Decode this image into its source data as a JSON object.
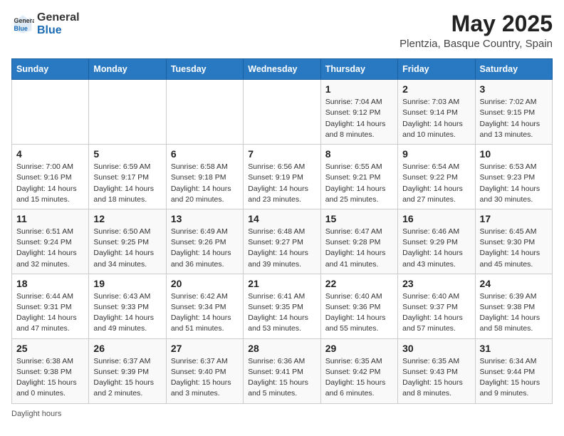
{
  "logo": {
    "line1": "General",
    "line2": "Blue"
  },
  "title": "May 2025",
  "location": "Plentzia, Basque Country, Spain",
  "days_of_week": [
    "Sunday",
    "Monday",
    "Tuesday",
    "Wednesday",
    "Thursday",
    "Friday",
    "Saturday"
  ],
  "legend_label": "Daylight hours",
  "weeks": [
    [
      {
        "day": "",
        "info": ""
      },
      {
        "day": "",
        "info": ""
      },
      {
        "day": "",
        "info": ""
      },
      {
        "day": "",
        "info": ""
      },
      {
        "day": "1",
        "info": "Sunrise: 7:04 AM\nSunset: 9:12 PM\nDaylight: 14 hours\nand 8 minutes."
      },
      {
        "day": "2",
        "info": "Sunrise: 7:03 AM\nSunset: 9:14 PM\nDaylight: 14 hours\nand 10 minutes."
      },
      {
        "day": "3",
        "info": "Sunrise: 7:02 AM\nSunset: 9:15 PM\nDaylight: 14 hours\nand 13 minutes."
      }
    ],
    [
      {
        "day": "4",
        "info": "Sunrise: 7:00 AM\nSunset: 9:16 PM\nDaylight: 14 hours\nand 15 minutes."
      },
      {
        "day": "5",
        "info": "Sunrise: 6:59 AM\nSunset: 9:17 PM\nDaylight: 14 hours\nand 18 minutes."
      },
      {
        "day": "6",
        "info": "Sunrise: 6:58 AM\nSunset: 9:18 PM\nDaylight: 14 hours\nand 20 minutes."
      },
      {
        "day": "7",
        "info": "Sunrise: 6:56 AM\nSunset: 9:19 PM\nDaylight: 14 hours\nand 23 minutes."
      },
      {
        "day": "8",
        "info": "Sunrise: 6:55 AM\nSunset: 9:21 PM\nDaylight: 14 hours\nand 25 minutes."
      },
      {
        "day": "9",
        "info": "Sunrise: 6:54 AM\nSunset: 9:22 PM\nDaylight: 14 hours\nand 27 minutes."
      },
      {
        "day": "10",
        "info": "Sunrise: 6:53 AM\nSunset: 9:23 PM\nDaylight: 14 hours\nand 30 minutes."
      }
    ],
    [
      {
        "day": "11",
        "info": "Sunrise: 6:51 AM\nSunset: 9:24 PM\nDaylight: 14 hours\nand 32 minutes."
      },
      {
        "day": "12",
        "info": "Sunrise: 6:50 AM\nSunset: 9:25 PM\nDaylight: 14 hours\nand 34 minutes."
      },
      {
        "day": "13",
        "info": "Sunrise: 6:49 AM\nSunset: 9:26 PM\nDaylight: 14 hours\nand 36 minutes."
      },
      {
        "day": "14",
        "info": "Sunrise: 6:48 AM\nSunset: 9:27 PM\nDaylight: 14 hours\nand 39 minutes."
      },
      {
        "day": "15",
        "info": "Sunrise: 6:47 AM\nSunset: 9:28 PM\nDaylight: 14 hours\nand 41 minutes."
      },
      {
        "day": "16",
        "info": "Sunrise: 6:46 AM\nSunset: 9:29 PM\nDaylight: 14 hours\nand 43 minutes."
      },
      {
        "day": "17",
        "info": "Sunrise: 6:45 AM\nSunset: 9:30 PM\nDaylight: 14 hours\nand 45 minutes."
      }
    ],
    [
      {
        "day": "18",
        "info": "Sunrise: 6:44 AM\nSunset: 9:31 PM\nDaylight: 14 hours\nand 47 minutes."
      },
      {
        "day": "19",
        "info": "Sunrise: 6:43 AM\nSunset: 9:33 PM\nDaylight: 14 hours\nand 49 minutes."
      },
      {
        "day": "20",
        "info": "Sunrise: 6:42 AM\nSunset: 9:34 PM\nDaylight: 14 hours\nand 51 minutes."
      },
      {
        "day": "21",
        "info": "Sunrise: 6:41 AM\nSunset: 9:35 PM\nDaylight: 14 hours\nand 53 minutes."
      },
      {
        "day": "22",
        "info": "Sunrise: 6:40 AM\nSunset: 9:36 PM\nDaylight: 14 hours\nand 55 minutes."
      },
      {
        "day": "23",
        "info": "Sunrise: 6:40 AM\nSunset: 9:37 PM\nDaylight: 14 hours\nand 57 minutes."
      },
      {
        "day": "24",
        "info": "Sunrise: 6:39 AM\nSunset: 9:38 PM\nDaylight: 14 hours\nand 58 minutes."
      }
    ],
    [
      {
        "day": "25",
        "info": "Sunrise: 6:38 AM\nSunset: 9:38 PM\nDaylight: 15 hours\nand 0 minutes."
      },
      {
        "day": "26",
        "info": "Sunrise: 6:37 AM\nSunset: 9:39 PM\nDaylight: 15 hours\nand 2 minutes."
      },
      {
        "day": "27",
        "info": "Sunrise: 6:37 AM\nSunset: 9:40 PM\nDaylight: 15 hours\nand 3 minutes."
      },
      {
        "day": "28",
        "info": "Sunrise: 6:36 AM\nSunset: 9:41 PM\nDaylight: 15 hours\nand 5 minutes."
      },
      {
        "day": "29",
        "info": "Sunrise: 6:35 AM\nSunset: 9:42 PM\nDaylight: 15 hours\nand 6 minutes."
      },
      {
        "day": "30",
        "info": "Sunrise: 6:35 AM\nSunset: 9:43 PM\nDaylight: 15 hours\nand 8 minutes."
      },
      {
        "day": "31",
        "info": "Sunrise: 6:34 AM\nSunset: 9:44 PM\nDaylight: 15 hours\nand 9 minutes."
      }
    ]
  ]
}
